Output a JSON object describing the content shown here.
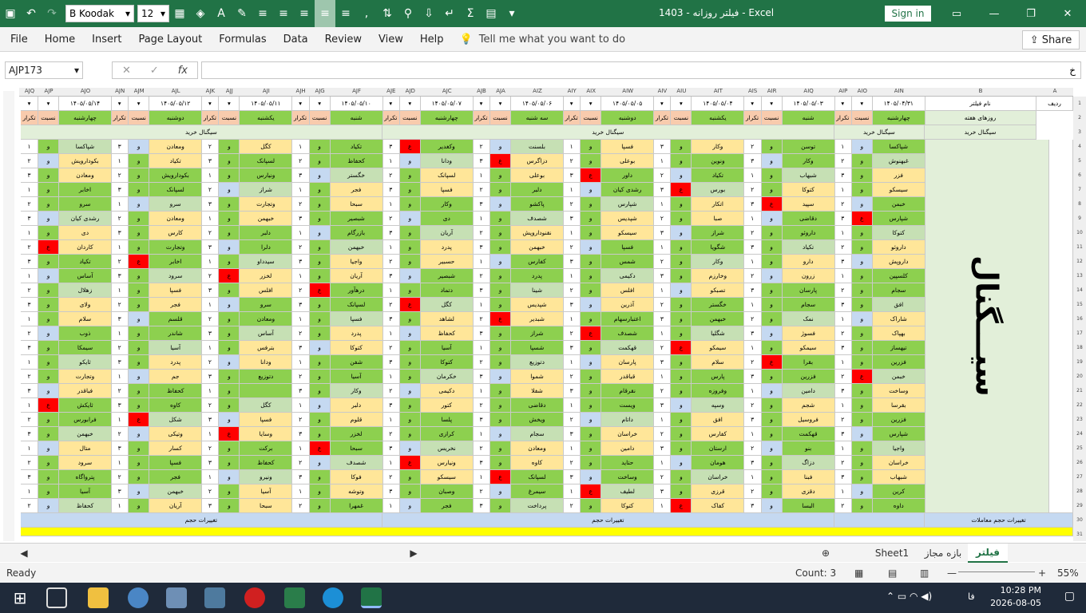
{
  "window": {
    "title": "فیلتر روزانه - 1403  -  Excel",
    "sign_in": "Sign in",
    "font_name": "B Koodak",
    "font_size": "12"
  },
  "menu": [
    "File",
    "Home",
    "Insert",
    "Page Layout",
    "Formulas",
    "Data",
    "Review",
    "View",
    "Help"
  ],
  "tell_me": "Tell me what you want to do",
  "share": "Share",
  "name_box": "AJP173",
  "formula_value": "خ",
  "sheet_header": {
    "filter_name_label": "نام فیلتر",
    "row_label": "ردیف",
    "weekdays_label": "روزهای هفته",
    "buy_signal": "سیگنال خرید",
    "volume_change": "تغییرات حجم",
    "volume_change_trades": "تغییرات حجم معاملات",
    "big_label": "سیـــگنال"
  },
  "columns": [
    {
      "letters": [
        "AIN",
        "AIO",
        "AIP"
      ],
      "date": "۱۴۰۵/۰۴/۳۱",
      "day": "چهارشنبه"
    },
    {
      "letters": [
        "AIQ",
        "AIR",
        "AIS"
      ],
      "date": "۱۴۰۵/۰۵/۰۳",
      "day": "شنبه"
    },
    {
      "letters": [
        "AIT",
        "AIU",
        "AIV"
      ],
      "date": "۱۴۰۵/۰۵/۰۴",
      "day": "یکشنبه"
    },
    {
      "letters": [
        "AIW",
        "AIX",
        "AIY"
      ],
      "date": "۱۴۰۵/۰۵/۰۵",
      "day": "دوشنبه"
    },
    {
      "letters": [
        "AIZ",
        "AJA",
        "AJB"
      ],
      "date": "۱۴۰۵/۰۵/۰۶",
      "day": "سه شنبه"
    },
    {
      "letters": [
        "AJC",
        "AJD",
        "AJE"
      ],
      "date": "۱۴۰۵/۰۵/۰۷",
      "day": "چهارشنبه"
    },
    {
      "letters": [
        "AJF",
        "AJG",
        "AJH"
      ],
      "date": "۱۴۰۵/۰۵/۱۰",
      "day": "شنبه"
    },
    {
      "letters": [
        "AJI",
        "AJJ",
        "AJK"
      ],
      "date": "۱۴۰۵/۰۵/۱۱",
      "day": "یکشنبه"
    },
    {
      "letters": [
        "AJL",
        "AJM",
        "AJN"
      ],
      "date": "۱۴۰۵/۰۵/۱۲",
      "day": "دوشنبه"
    },
    {
      "letters": [
        "AJO",
        "AJP",
        "AJQ"
      ],
      "date": "۱۴۰۵/۰۵/۱۴",
      "day": "چهارشنبه"
    }
  ],
  "sub_labels": {
    "ratio": "نسبت",
    "repeat": "تکرار"
  },
  "symbols": [
    [
      "شپاکسا",
      "توسن",
      "وکار",
      "فسپا",
      "بلسنت",
      "وکغدیر",
      "تکیاد",
      "کگل",
      "ومعادن",
      "شپاکسا"
    ],
    [
      "غبهنوش",
      "وکار",
      "ونوین",
      "بوعلی",
      "دزاگرس",
      "ودانا",
      "کحفاظ",
      "لسپانک",
      "تکیاد",
      "بکودارویش"
    ],
    [
      "فزر",
      "شبهاب",
      "تکیاد",
      "داور",
      "بوعلی",
      "لسپانک",
      "خگستر",
      "ونیارس",
      "بکودارویش",
      "ومعادن"
    ],
    [
      "سیسکو",
      "کتوکا",
      "بورس",
      "رشدی کیان",
      "دلبر",
      "فسپا",
      "فجر",
      "شراز",
      "لسپانک",
      "اخابر"
    ],
    [
      "خبمن",
      "سپید",
      "اتکار",
      "شپارس",
      "پاکشو",
      "وکار",
      "سبحا",
      "وتجارت",
      "سرو",
      "سرو"
    ],
    [
      "شپارس",
      "دقاضی",
      "صبا",
      "شپدیس",
      "شصدف",
      "دی",
      "شبصیر",
      "خبهمن",
      "ومعادن",
      "رشدی کیان"
    ],
    [
      "کتوکا",
      "داروئو",
      "شراز",
      "سیسکو",
      "نقنوداروپش",
      "آریان",
      "بازرگام",
      "دلبر",
      "کارس",
      "دی"
    ],
    [
      "داروئو",
      "تکیاد",
      "شگویا",
      "فسپا",
      "خبهمن",
      "پدرد",
      "خبهمن",
      "دلرا",
      "وتجارت",
      "کاردان"
    ],
    [
      "داروپش",
      "دارو",
      "وکار",
      "شمس",
      "کفارس",
      "حسبیر",
      "واجیا",
      "سیدداو",
      "اخابر",
      "تکیاد"
    ],
    [
      "کلسپین",
      "زرون",
      "وخارزم",
      "دکیمی",
      "پدرد",
      "شبصیر",
      "آریان",
      "لخزر",
      "سرود",
      "آساس"
    ],
    [
      "سجام",
      "پارسان",
      "تصبکو",
      "افلس",
      "شینا",
      "دتماد",
      "درهآور",
      "افلس",
      "فسپا",
      "زهلال"
    ],
    [
      "افق",
      "سجام",
      "خگستر",
      "آذرین",
      "شپدیس",
      "کگل",
      "لسپانک",
      "سرو",
      "فجر",
      "ولای"
    ],
    [
      "شاراک",
      "نمک",
      "خبهمن",
      "اعتبارسهام",
      "شبدیر",
      "لشاهد",
      "فسپا",
      "ومعادن",
      "قلسم",
      "سلام"
    ],
    [
      "بهپاک",
      "فسوژ",
      "شگلیا",
      "شصدف",
      "شراز",
      "کحفاظ",
      "پدرد",
      "آساس",
      "شاندر",
      "ذوب"
    ],
    [
      "تیهساز",
      "سیمکو",
      "سیمکو",
      "قهکمت",
      "شسپا",
      "آسیا",
      "کتوکا",
      "بترفس",
      "آسیا",
      "سیمکا"
    ],
    [
      "فزرین",
      "بقرا",
      "سلام",
      "پارسان",
      "دتوزیع",
      "کتوکا",
      "شفن",
      "ودانا",
      "پدرد",
      "ثایکو"
    ],
    [
      "خبمن",
      "فزرین",
      "پارس",
      "قباقدر",
      "شموا",
      "خکرمان",
      "آسیا",
      "دتوزیع",
      "جم",
      "وتجارت"
    ],
    [
      "وساخت",
      "دامین",
      "وفروزه",
      "نقرقام",
      "شفلا",
      "دکیمی",
      "وکار",
      "",
      "کحفاظ",
      "فباقدر"
    ],
    [
      "بقرسا",
      "شجم",
      "وسپه",
      "ویست",
      "دقاضی",
      "کتور",
      "دلبر",
      "کگل",
      "کاوه",
      "ثایکش"
    ],
    [
      "فزرین",
      "فروسیل",
      "افق",
      "داتام",
      "ویخش",
      "پلسا",
      "قلوم",
      "فسپا",
      "شکل",
      "فرابورس"
    ],
    [
      "شپارس",
      "قهکمت",
      "کفارس",
      "خراسان",
      "سجام",
      "کرازی",
      "لخزر",
      "وسایا",
      "وتیکی",
      "خبهمن"
    ],
    [
      "واجیا",
      "بنو",
      "ارستان",
      "دامین",
      "ومعادن",
      "نخریس",
      "سبحا",
      "برکت",
      "کسار",
      "متال"
    ],
    [
      "خراسان",
      "دزاگ",
      "هومان",
      "حتاید",
      "کاوه",
      "ونیارس",
      "شصدف",
      "کحفاظ",
      "فسپا",
      "سرود"
    ],
    [
      "شبهاب",
      "فبنا",
      "خراسان",
      "وساخت",
      "لسپانک",
      "سیسکو",
      "فوکا",
      "ونیرو",
      "فجر",
      "پترواگاه"
    ],
    [
      "کرین",
      "دقزی",
      "قرزی",
      "لطیف",
      "سیمرغ",
      "وصبان",
      "وتوشه",
      "آسیا",
      "خبهمن",
      "آسیا"
    ],
    [
      "داوه",
      "البسا",
      "کفاک",
      "کتوکا",
      "پرداخت",
      "فجر",
      "غمهرا",
      "سبحا",
      "آریان",
      "کحفاظ"
    ]
  ],
  "ratio_marks": [
    "و",
    "ع"
  ],
  "repeat_values": [
    "۱",
    "۲",
    "۳"
  ],
  "sheet_tabs": [
    "فیلتر",
    "بازه مجاز",
    "Sheet1"
  ],
  "status": {
    "ready": "Ready",
    "count": "Count: 3",
    "zoom": "55%"
  },
  "taskbar": {
    "time": "10:28 PM",
    "date": "2026-08-05",
    "lang": "فا"
  }
}
